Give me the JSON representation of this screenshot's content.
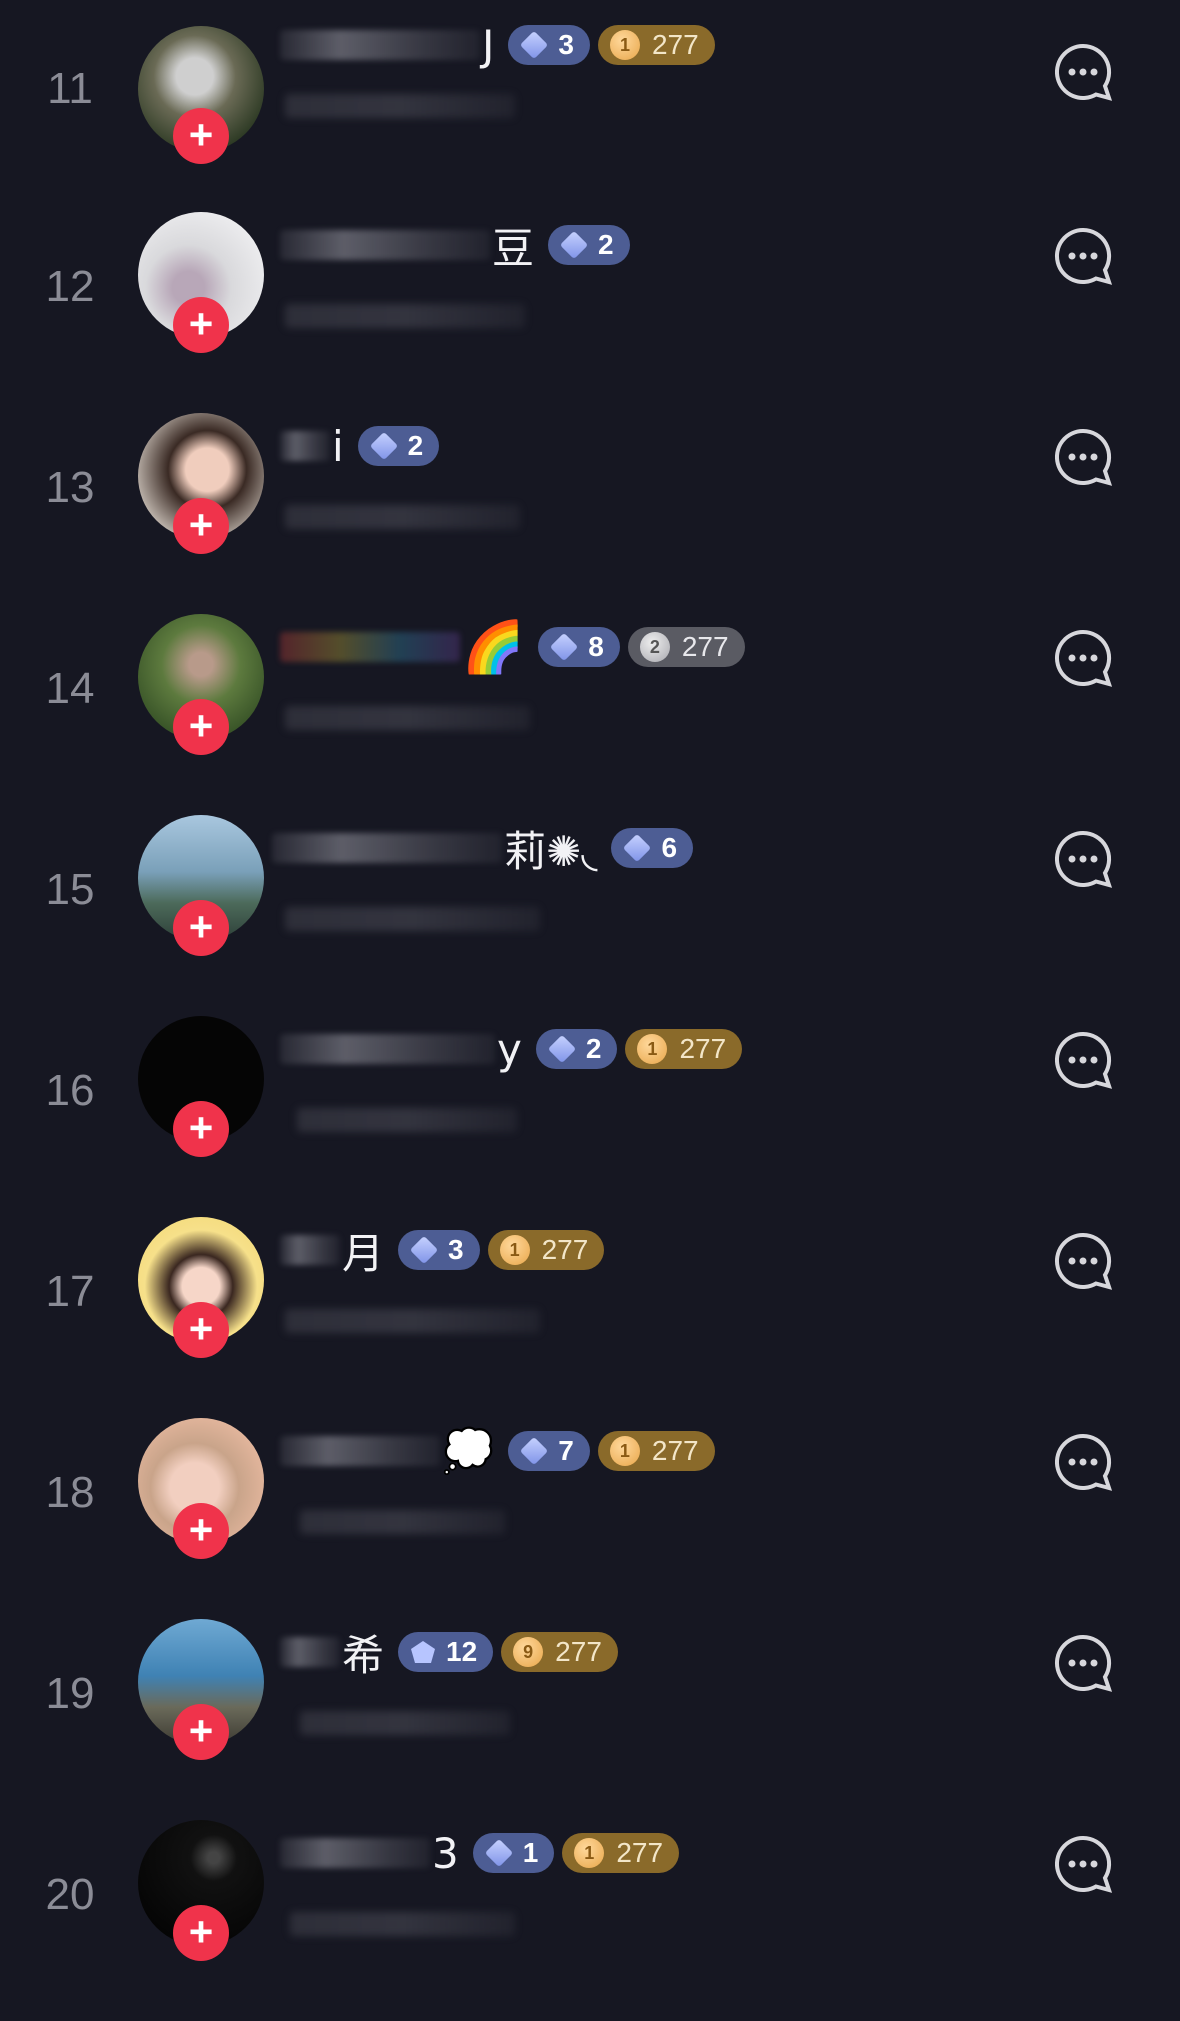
{
  "rows": [
    {
      "rank": "11",
      "name_suffix": "J",
      "level": "3",
      "score": "277",
      "score_style": "gold",
      "score_heart": "1"
    },
    {
      "rank": "12",
      "name_suffix": "豆",
      "level": "2",
      "score": null
    },
    {
      "rank": "13",
      "name_suffix": "i",
      "level": "2",
      "score": null
    },
    {
      "rank": "14",
      "name_suffix": "🌈",
      "level": "8",
      "score": "277",
      "score_style": "gray",
      "score_heart": "2"
    },
    {
      "rank": "15",
      "name_suffix": "莉✺◟",
      "level": "6",
      "score": null
    },
    {
      "rank": "16",
      "name_suffix": "y",
      "level": "2",
      "score": "277",
      "score_style": "gold",
      "score_heart": "1"
    },
    {
      "rank": "17",
      "name_suffix": "月",
      "level": "3",
      "score": "277",
      "score_style": "gold",
      "score_heart": "1"
    },
    {
      "rank": "18",
      "name_suffix": "💭",
      "level": "7",
      "score": "277",
      "score_style": "gold",
      "score_heart": "1"
    },
    {
      "rank": "19",
      "name_suffix": "希",
      "level": "12",
      "score": "277",
      "score_style": "gold",
      "score_heart": "9"
    },
    {
      "rank": "20",
      "name_suffix": "3",
      "level": "1",
      "score": "277",
      "score_style": "gold",
      "score_heart": "1"
    }
  ],
  "icons": {
    "follow": "plus-icon",
    "message": "chat-bubble-icon",
    "level": "diamond-icon",
    "score": "heart-icon"
  },
  "colors": {
    "background": "#161722",
    "follow": "#f0334b",
    "level_badge": "#4d5d94",
    "gold_badge": "#8a6a2a"
  }
}
